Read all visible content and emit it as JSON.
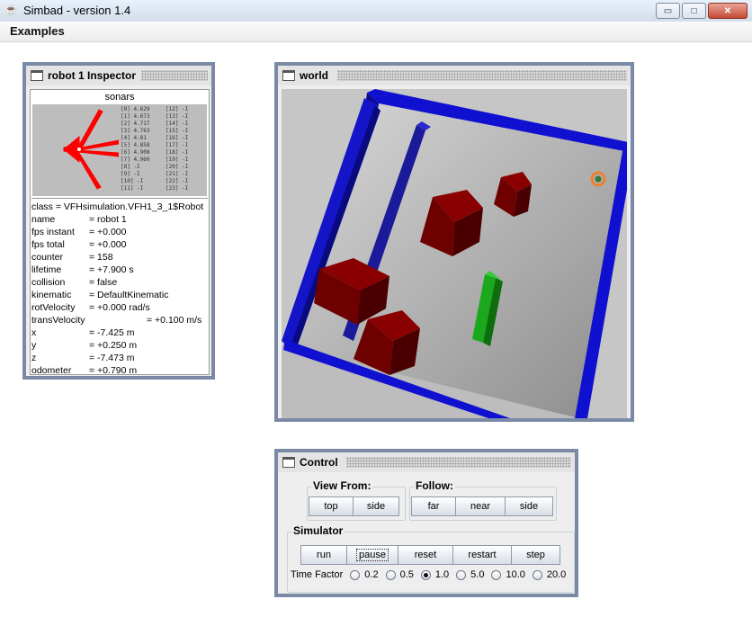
{
  "window": {
    "title": "Simbad  - version 1.4",
    "minimize": "▭",
    "maximize": "□",
    "close": "✕"
  },
  "menu": {
    "examples": "Examples"
  },
  "inspector": {
    "title": "robot 1 Inspector",
    "sonars_label": "sonars",
    "sonar_readings_left": [
      "[0] 4.629",
      "[1] 4.673",
      "[2] 4.717",
      "[3] 4.763",
      "[4] 4.81",
      "[5] 4.858",
      "[6] 4.908",
      "[7] 4.960",
      "[8] -I",
      "[9] -I",
      "[10] -I",
      "[11] -I"
    ],
    "sonar_readings_right": [
      "[12] -I",
      "[13] -I",
      "[14] -I",
      "[15] -I",
      "[16] -I",
      "[17] -I",
      "[18] -I",
      "[19] -I",
      "[20] -I",
      "[21] -I",
      "[22] -I",
      "[23] -I"
    ],
    "class_line": "class = VFHsimulation.VFH1_3_1$Robot",
    "properties": [
      {
        "key": "name",
        "value": "= robot 1"
      },
      {
        "key": "fps instant",
        "value": "= +0.000"
      },
      {
        "key": "fps total",
        "value": "= +0.000"
      },
      {
        "key": "counter",
        "value": "= 158"
      },
      {
        "key": "lifetime",
        "value": "= +7.900 s"
      },
      {
        "key": "collision",
        "value": "= false"
      },
      {
        "key": "kinematic",
        "value": "= DefaultKinematic"
      },
      {
        "key": "rotVelocity",
        "value": "= +0.000 rad/s"
      },
      {
        "key": "transVelocity",
        "value": "= +0.100 m/s"
      },
      {
        "key": "x",
        "value": "= -7.425 m"
      },
      {
        "key": "y",
        "value": "= +0.250 m"
      },
      {
        "key": "z",
        "value": "= -7.473 m"
      },
      {
        "key": "odometer",
        "value": "= +0.790 m"
      }
    ]
  },
  "world": {
    "title": "world"
  },
  "control": {
    "title": "Control",
    "view_from_label": "View From:",
    "view_from_buttons": [
      "top",
      "side"
    ],
    "follow_label": "Follow:",
    "follow_buttons": [
      "far",
      "near",
      "side"
    ],
    "simulator_label": "Simulator",
    "simulator_buttons": [
      "run",
      "pause",
      "reset",
      "restart",
      "step"
    ],
    "time_factor_label": "Time Factor",
    "time_factor_options": [
      "0.2",
      "0.5",
      "1.0",
      "5.0",
      "10.0",
      "20.0"
    ],
    "time_factor_selected": "1.0"
  },
  "colors": {
    "frame_border": "#7a8aa6",
    "wall_blue": "#1010d0",
    "box_red": "#7a0000",
    "bar_green": "#1c9e1c",
    "robot_orange": "#f08030"
  }
}
